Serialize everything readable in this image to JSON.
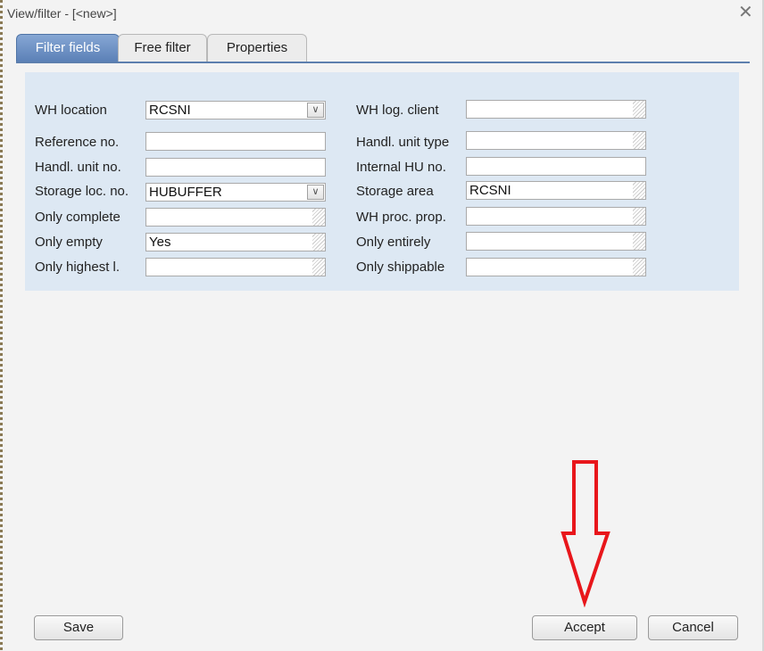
{
  "window": {
    "title": "View/filter - [<new>]",
    "close_glyph": "✕"
  },
  "tabs": [
    {
      "label": "Filter fields",
      "active": true
    },
    {
      "label": "Free filter",
      "active": false
    },
    {
      "label": "Properties",
      "active": false
    }
  ],
  "form": {
    "left": [
      {
        "label": "WH location",
        "value": "RCSNI",
        "kind": "dropdown"
      },
      {
        "label": "Reference no.",
        "value": "",
        "kind": "text"
      },
      {
        "label": "Handl. unit no.",
        "value": "",
        "kind": "text"
      },
      {
        "label": "Storage loc. no.",
        "value": "HUBUFFER",
        "kind": "dropdown"
      },
      {
        "label": "Only complete",
        "value": "",
        "kind": "select"
      },
      {
        "label": "Only empty",
        "value": "Yes",
        "kind": "select"
      },
      {
        "label": "Only highest l.",
        "value": "",
        "kind": "select"
      }
    ],
    "right": [
      {
        "label": "WH log. client",
        "value": "",
        "kind": "select"
      },
      {
        "label": "Handl. unit type",
        "value": "",
        "kind": "select"
      },
      {
        "label": "Internal HU no.",
        "value": "",
        "kind": "text"
      },
      {
        "label": "Storage area",
        "value": "RCSNI",
        "kind": "select"
      },
      {
        "label": "WH proc. prop.",
        "value": "",
        "kind": "select"
      },
      {
        "label": "Only entirely",
        "value": "",
        "kind": "select"
      },
      {
        "label": "Only shippable",
        "value": "",
        "kind": "select"
      }
    ],
    "dropdown_glyph": "∨"
  },
  "buttons": {
    "save": "Save",
    "accept": "Accept",
    "cancel": "Cancel"
  },
  "annotation": {
    "arrow_color": "#e8161b",
    "direction": "down",
    "points_to": "Accept"
  }
}
